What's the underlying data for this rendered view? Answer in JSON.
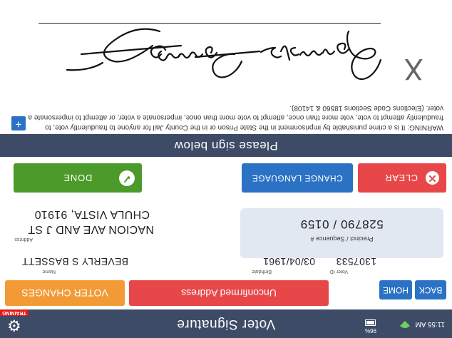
{
  "status_bar": {
    "time": "11:55 AM",
    "battery_pct": "96%",
    "title": "Voter Signature",
    "training_badge": "TRAINING"
  },
  "nav": {
    "back": "BACK",
    "home": "HOME",
    "unconfirmed": "Unconfirmed Address",
    "voter_changes": "VOTER CHANGES"
  },
  "voter": {
    "name_label": "Name",
    "name": "BEVERLY S BASSETT",
    "birthdate_label": "Birthdate",
    "birthdate": "03/04/1961",
    "voter_id_label": "Voter ID",
    "voter_id": "1307533",
    "address_label": "Address",
    "address_line1": "NACION AVE AND J ST",
    "address_line2": "CHULA VISTA, 91910",
    "precinct_label": "Precinct / Sequence #",
    "precinct": "528790 / 0159"
  },
  "actions": {
    "clear": "CLEAR",
    "change_language": "CHANGE LANGUAGE",
    "done": "DONE"
  },
  "sign_banner": "Please sign below",
  "warning": "WARNING: It is a crime punishable by imprisonment in the State Prison or in the County Jail for anyone to fraudulently vote, to fraudulently attempt to vote, vote more than once, attempt to vote more than once, impersonate a voter, or attempt to impersonate a voter. (Elections Code Sections 18560 & 14108).",
  "signature": {
    "x_mark": "X"
  },
  "colors": {
    "header": "#3d4b66",
    "blue": "#2b72c4",
    "red": "#e8474a",
    "orange": "#f29b36",
    "green": "#4c9a2a"
  }
}
